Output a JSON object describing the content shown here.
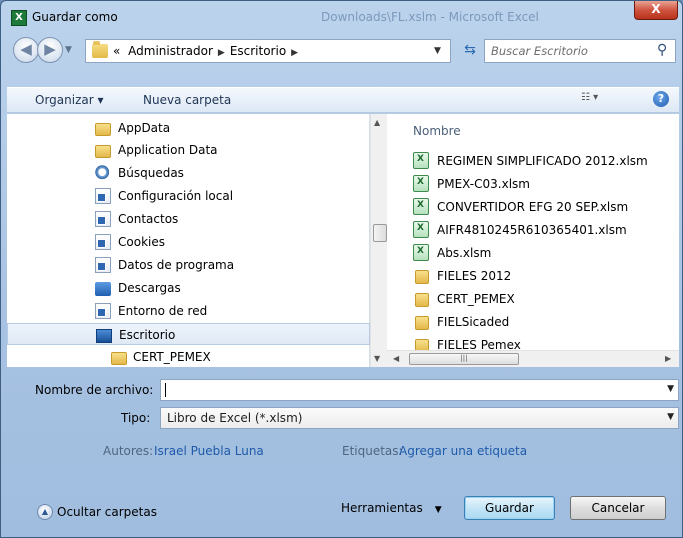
{
  "window": {
    "title": "Guardar como",
    "background_title": "Downloads\\FL.xslm - Microsoft Excel",
    "close_label": "X",
    "app_icon_glyph": "X"
  },
  "nav": {
    "back_icon": "back-arrow-icon",
    "forward_icon": "forward-arrow-icon",
    "breadcrumb_prefix": "«",
    "breadcrumbs": [
      "Administrador",
      "Escritorio"
    ],
    "search_placeholder": "Buscar Escritorio"
  },
  "toolbar": {
    "organize_label": "Organizar ▾",
    "new_folder_label": "Nueva carpeta",
    "views_glyph": "☷ ▾",
    "help_glyph": "?"
  },
  "tree": {
    "items": [
      {
        "label": "AppData",
        "icon": "folder"
      },
      {
        "label": "Application Data",
        "icon": "folder"
      },
      {
        "label": "Búsquedas",
        "icon": "search-folder"
      },
      {
        "label": "Configuración local",
        "icon": "shortcut"
      },
      {
        "label": "Contactos",
        "icon": "contacts"
      },
      {
        "label": "Cookies",
        "icon": "shortcut"
      },
      {
        "label": "Datos de programa",
        "icon": "shortcut"
      },
      {
        "label": "Descargas",
        "icon": "downloads"
      },
      {
        "label": "Entorno de red",
        "icon": "shortcut"
      },
      {
        "label": "Escritorio",
        "icon": "desktop",
        "selected": true
      },
      {
        "label": "CERT_PEMEX",
        "icon": "folder"
      }
    ]
  },
  "files": {
    "column_header": "Nombre",
    "items": [
      {
        "name": "REGIMEN  SIMPLIFICADO 2012.xlsm",
        "type": "excel"
      },
      {
        "name": "PMEX-C03.xlsm",
        "type": "excel"
      },
      {
        "name": "CONVERTIDOR EFG 20 SEP.xlsm",
        "type": "excel"
      },
      {
        "name": "AIFR4810245R610365401.xlsm",
        "type": "excel"
      },
      {
        "name": "Abs.xlsm",
        "type": "excel"
      },
      {
        "name": "FIELES 2012",
        "type": "folder"
      },
      {
        "name": "CERT_PEMEX",
        "type": "folder"
      },
      {
        "name": "FIELSicaded",
        "type": "folder"
      },
      {
        "name": "FIELES Pemex",
        "type": "folder"
      }
    ]
  },
  "form": {
    "filename_label": "Nombre de archivo:",
    "filename_value": "",
    "type_label": "Tipo:",
    "type_value": "Libro de Excel (*.xlsm)",
    "authors_label": "Autores:",
    "authors_value": "Israel Puebla Luna",
    "tags_label": "Etiquetas:",
    "tags_value": "Agregar una etiqueta"
  },
  "footer": {
    "hide_folders_label": "Ocultar carpetas",
    "tools_label": "Herramientas",
    "save_label": "Guardar",
    "cancel_label": "Cancelar"
  }
}
